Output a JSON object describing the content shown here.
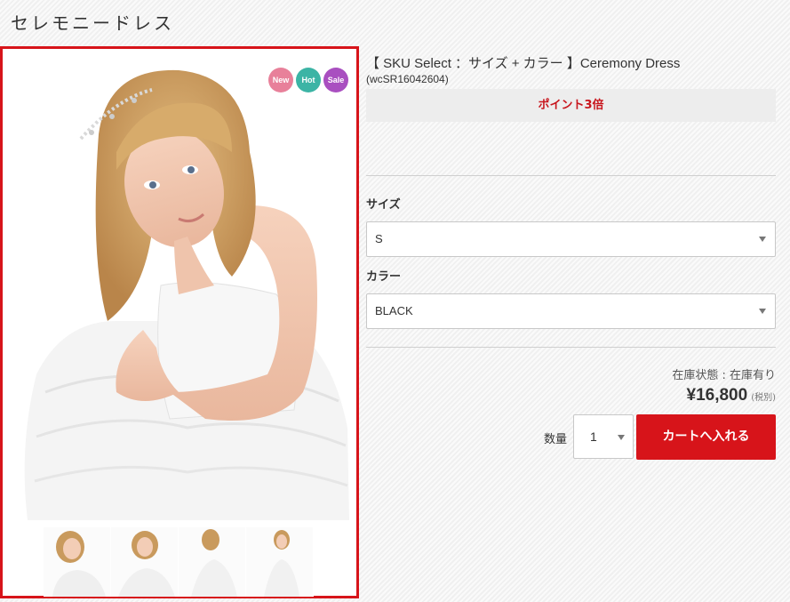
{
  "page": {
    "title": "セレモニードレス"
  },
  "gallery": {
    "badges": [
      {
        "label": "New",
        "color": "#e8809a"
      },
      {
        "label": "Hot",
        "color": "#3cb4a5"
      },
      {
        "label": "Sale",
        "color": "#a94fc0"
      }
    ],
    "accent_color": "#d7141a",
    "thumbnail_count": 4
  },
  "product": {
    "title": "【 SKU Select ：サイズ + カラー 】Ceremony Dress",
    "sku": "(wcSR16042604)",
    "points": "ポイント3倍"
  },
  "options": {
    "size_label": "サイズ",
    "size_value": "S",
    "color_label": "カラー",
    "color_value": "BLACK"
  },
  "purchase": {
    "stock": "在庫状態 : 在庫有り",
    "price": "¥16,800",
    "tax": "(税別)",
    "qty_label": "数量",
    "qty_value": "1",
    "cart_label": "カートへ入れる"
  }
}
